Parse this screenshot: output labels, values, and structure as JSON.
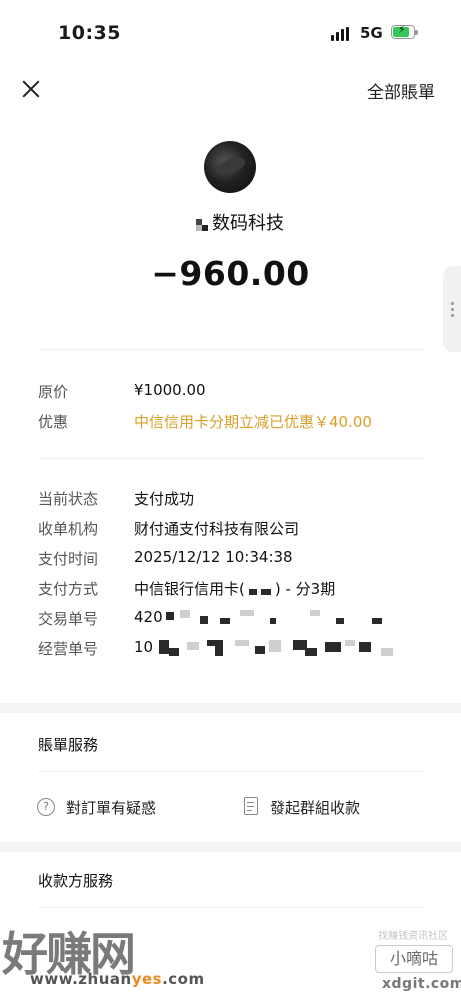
{
  "status_bar": {
    "time": "10:35",
    "network": "5G"
  },
  "header": {
    "close_icon": "close-icon",
    "all_bills": "全部賬單"
  },
  "merchant": {
    "name": "数码科技",
    "amount": "−960.00"
  },
  "pricing": {
    "original_label": "原价",
    "original_value": "¥1000.00",
    "discount_label": "优惠",
    "discount_value": "中信信用卡分期立减已优惠￥40.00",
    "discount_color": "#d9a02b"
  },
  "details": {
    "status_label": "当前状态",
    "status_value": "支付成功",
    "acquirer_label": "收单机构",
    "acquirer_value": "财付通支付科技有限公司",
    "time_label": "支付时间",
    "time_value": "2025/12/12 10:34:38",
    "method_label": "支付方式",
    "method_prefix": "中信银行信用卡(",
    "method_suffix": ") - 分3期",
    "txn_label": "交易单号",
    "txn_prefix": "420",
    "biz_label": "经营单号",
    "biz_prefix": "10"
  },
  "bill_service": {
    "title": "賬單服務",
    "dispute": "對訂單有疑惑",
    "group_collect": "發起群組收款"
  },
  "payee_service": {
    "title": "收款方服務"
  },
  "watermark": {
    "site_big": "好赚网",
    "url_a": "www.zhuan",
    "url_b": "yes",
    "url_c": ".com",
    "small_text": "找赚钱资讯社区",
    "box_label": "小嘀咕",
    "url2": "xdgit.com"
  }
}
